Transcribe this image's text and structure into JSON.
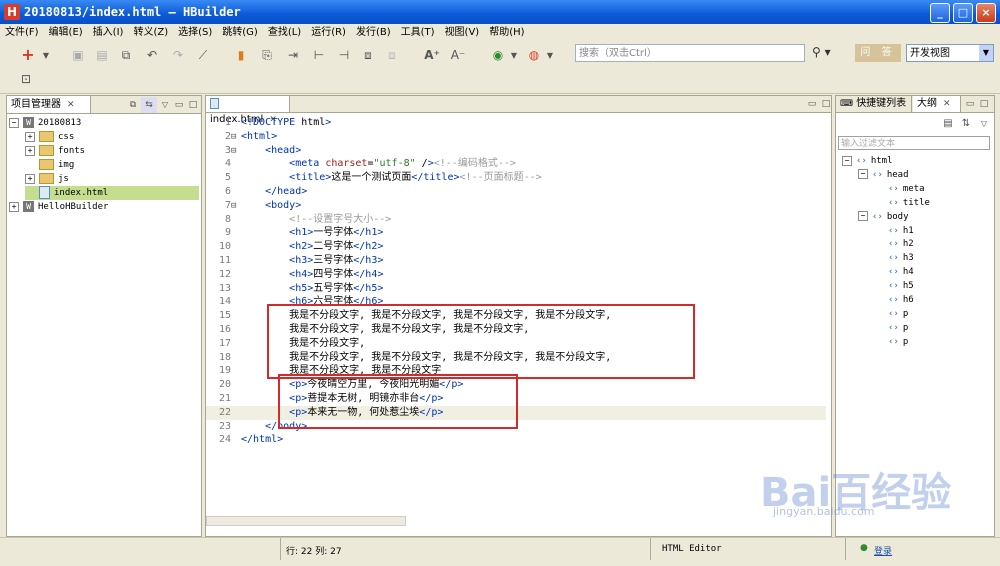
{
  "window": {
    "title": "20180813/index.html — HBuilder",
    "app_icon": "H"
  },
  "menu": [
    "文件(F)",
    "编辑(E)",
    "插入(I)",
    "转义(Z)",
    "选择(S)",
    "跳转(G)",
    "查找(L)",
    "运行(R)",
    "发行(B)",
    "工具(T)",
    "视图(V)",
    "帮助(H)"
  ],
  "toolbar": {
    "search_placeholder": "搜索（双击Ctrl）",
    "ask_label": "问 答",
    "view_select": "开发视图"
  },
  "project_panel": {
    "tab_label": "项目管理器",
    "tree": [
      {
        "label": "20180813",
        "type": "project",
        "expander": "−",
        "depth": 0
      },
      {
        "label": "css",
        "type": "folder",
        "expander": "+",
        "depth": 1
      },
      {
        "label": "fonts",
        "type": "folder",
        "expander": "+",
        "depth": 1
      },
      {
        "label": "img",
        "type": "folder",
        "expander": "",
        "depth": 1
      },
      {
        "label": "js",
        "type": "folder",
        "expander": "+",
        "depth": 1
      },
      {
        "label": "index.html",
        "type": "file",
        "expander": "",
        "depth": 1,
        "selected": true
      },
      {
        "label": "HelloHBuilder",
        "type": "project",
        "expander": "+",
        "depth": 0
      }
    ]
  },
  "editor": {
    "tab_label": "index.html",
    "lines": [
      {
        "n": "1",
        "t": "<!DOCTYPE html>"
      },
      {
        "n": "2",
        "t": "<html>"
      },
      {
        "n": "3",
        "t": "    <head>"
      },
      {
        "n": "4",
        "t": "        <meta charset=\"utf-8\" /><!--编码格式-->"
      },
      {
        "n": "5",
        "t": "        <title>这是一个测试页面</title><!--页面标题-->"
      },
      {
        "n": "6",
        "t": "    </head>"
      },
      {
        "n": "7",
        "t": "    <body>"
      },
      {
        "n": "8",
        "t": "        <!--设置字号大小-->"
      },
      {
        "n": "9",
        "t": "        <h1>一号字体</h1>"
      },
      {
        "n": "10",
        "t": "        <h2>二号字体</h2>"
      },
      {
        "n": "11",
        "t": "        <h3>三号字体</h3>"
      },
      {
        "n": "12",
        "t": "        <h4>四号字体</h4>"
      },
      {
        "n": "13",
        "t": "        <h5>五号字体</h5>"
      },
      {
        "n": "14",
        "t": "        <h6>六号字体</h6>"
      },
      {
        "n": "15",
        "t": "        我是不分段文字, 我是不分段文字, 我是不分段文字, 我是不分段文字,"
      },
      {
        "n": "16",
        "t": "        我是不分段文字, 我是不分段文字, 我是不分段文字,"
      },
      {
        "n": "17",
        "t": "        我是不分段文字,"
      },
      {
        "n": "18",
        "t": "        我是不分段文字, 我是不分段文字, 我是不分段文字, 我是不分段文字,"
      },
      {
        "n": "19",
        "t": "        我是不分段文字, 我是不分段文字"
      },
      {
        "n": "20",
        "t": "        <p>今夜晴空万里, 今夜阳光明媚</p>"
      },
      {
        "n": "21",
        "t": "        <p>菩提本无树, 明镜亦非台</p>"
      },
      {
        "n": "22",
        "t": "        <p>本来无一物, 何处惹尘埃</p>"
      },
      {
        "n": "23",
        "t": "    </body>"
      },
      {
        "n": "24",
        "t": "</html>"
      }
    ]
  },
  "right_panel": {
    "tab1": "快捷键列表",
    "tab2": "大纲",
    "filter_placeholder": "输入过滤文本",
    "outline": [
      {
        "label": "html",
        "depth": 0,
        "exp": "−"
      },
      {
        "label": "head",
        "depth": 1,
        "exp": "−"
      },
      {
        "label": "meta",
        "depth": 2,
        "exp": ""
      },
      {
        "label": "title",
        "depth": 2,
        "exp": ""
      },
      {
        "label": "body",
        "depth": 1,
        "exp": "−"
      },
      {
        "label": "h1",
        "depth": 2,
        "exp": ""
      },
      {
        "label": "h2",
        "depth": 2,
        "exp": ""
      },
      {
        "label": "h3",
        "depth": 2,
        "exp": ""
      },
      {
        "label": "h4",
        "depth": 2,
        "exp": ""
      },
      {
        "label": "h5",
        "depth": 2,
        "exp": ""
      },
      {
        "label": "h6",
        "depth": 2,
        "exp": ""
      },
      {
        "label": "p",
        "depth": 2,
        "exp": ""
      },
      {
        "label": "p",
        "depth": 2,
        "exp": ""
      },
      {
        "label": "p",
        "depth": 2,
        "exp": ""
      }
    ]
  },
  "status": {
    "position": "行: 22 列: 27",
    "editor_mode": "HTML Editor",
    "login": "登录"
  },
  "watermark": {
    "brand": "Bai百经验",
    "url": "jingyan.baidu.com"
  }
}
